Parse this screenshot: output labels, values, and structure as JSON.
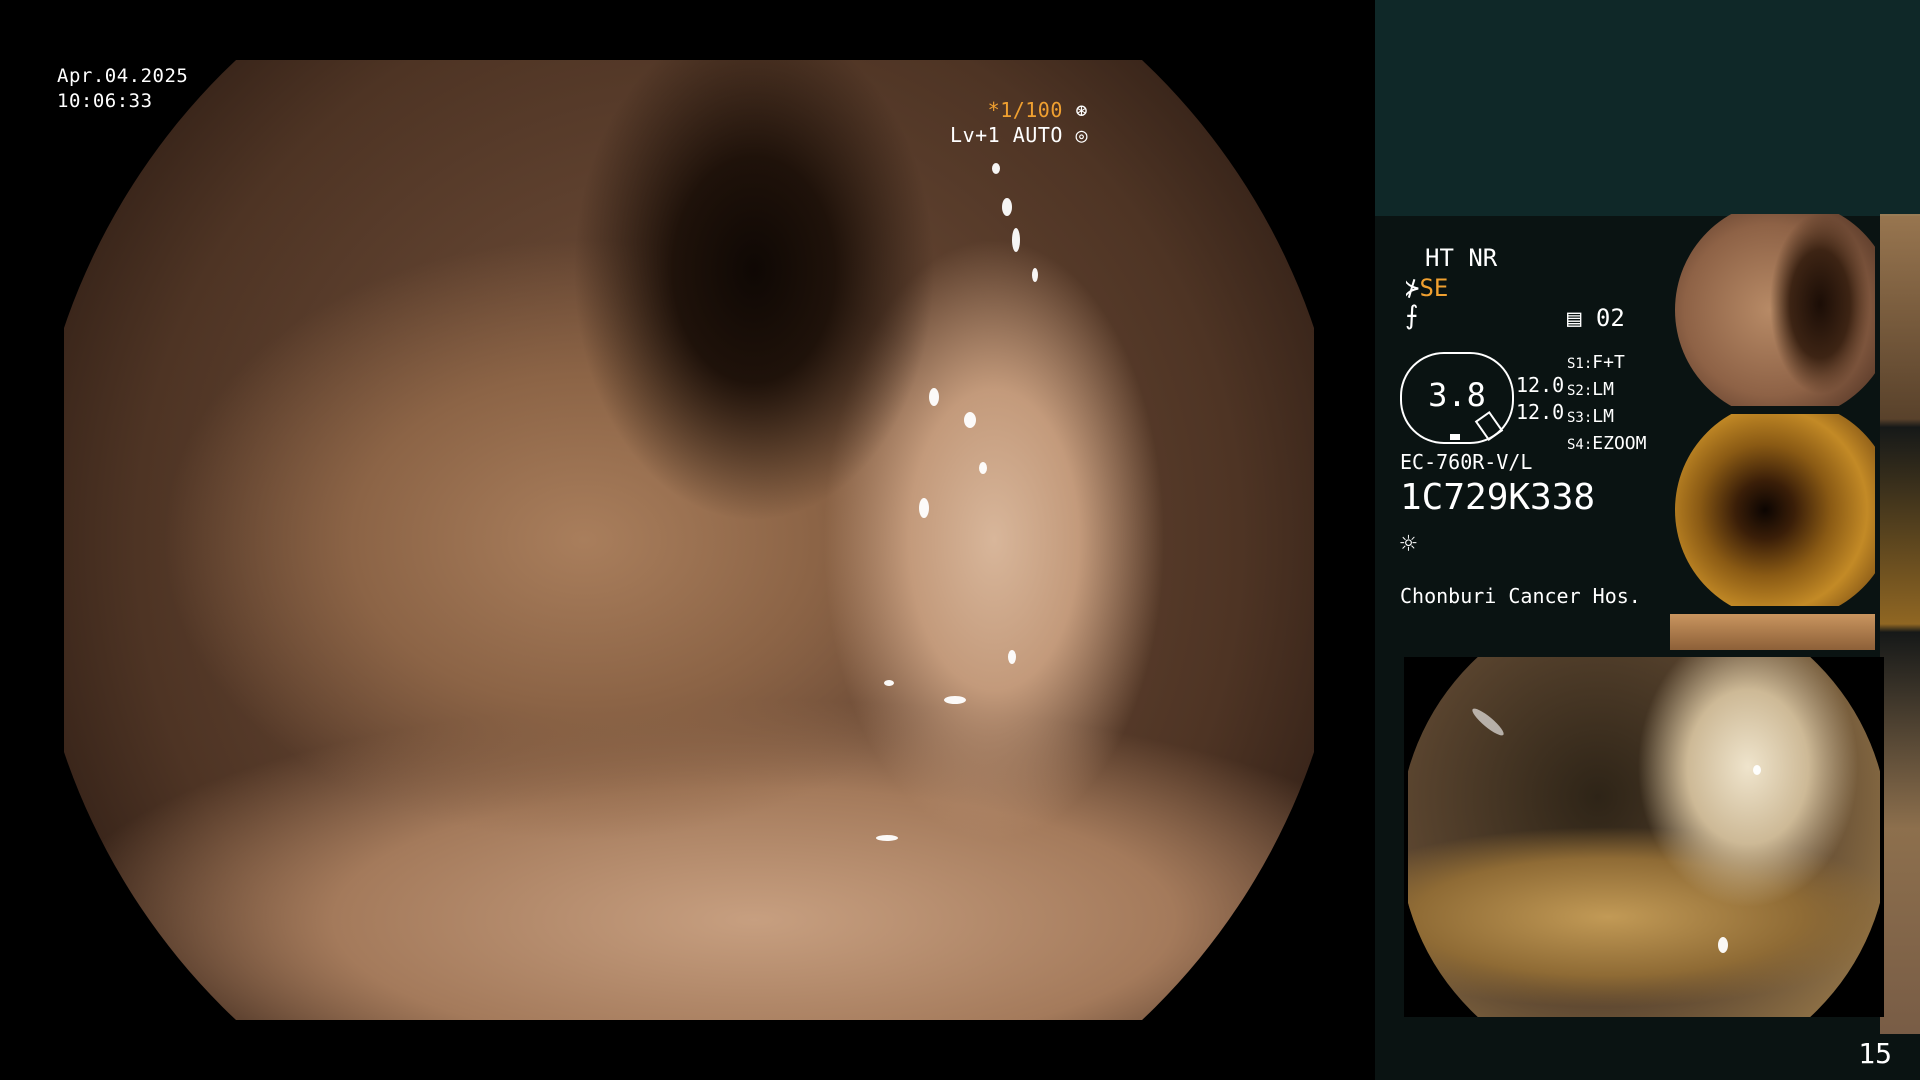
{
  "overlay": {
    "date": "Apr.04.2025",
    "time": "10:06:33",
    "shutter_prefix": "*",
    "shutter_speed": "1/100",
    "level": "Lv+1 AUTO"
  },
  "panel": {
    "mode_ht_nr": "HT NR",
    "se_label": "SE",
    "scope_count": "02",
    "gauge_value": "3.8",
    "gauge_side_values": [
      "12.0",
      "12.0"
    ],
    "settings": [
      {
        "key": "S1:",
        "value": "F+T"
      },
      {
        "key": "S2:",
        "value": "LM"
      },
      {
        "key": "S3:",
        "value": "LM"
      },
      {
        "key": "S4:",
        "value": "EZOOM"
      }
    ],
    "scope_model": "EC-760R-V/L",
    "serial": "1C729K338",
    "hospital": "Chonburi Cancer Hos.",
    "page_number": "15"
  },
  "icons": [
    "aperture-icon",
    "iris-icon",
    "scope-tip-icon",
    "filter-icon",
    "memory-icon",
    "light-icon"
  ]
}
